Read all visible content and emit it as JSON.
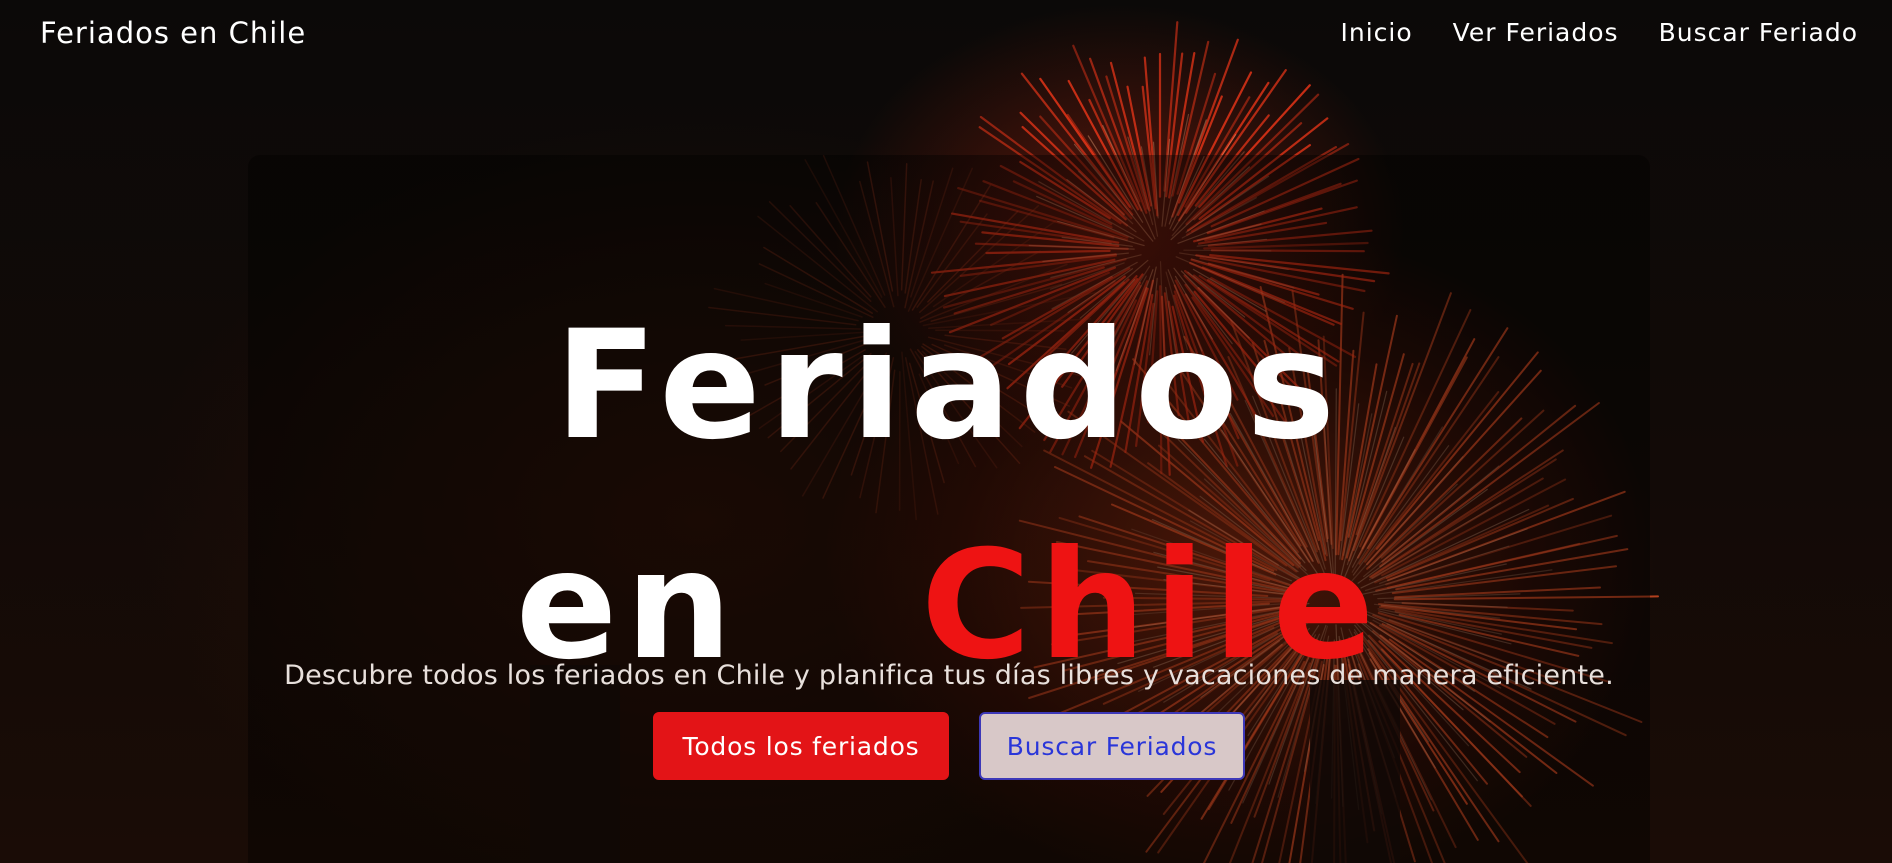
{
  "navbar": {
    "brand": "Feriados en Chile",
    "links": [
      "Inicio",
      "Ver Feriados",
      "Buscar Feriado"
    ]
  },
  "hero": {
    "title_line_1": "Feriados",
    "title_line_2_white": "en",
    "title_line_2_red": "Chile",
    "subtitle": "Descubre todos los feriados en Chile y planifica tus días libres y vacaciones de manera eficiente.",
    "primary_button": "Todos los feriados",
    "secondary_button": "Buscar Feriados"
  },
  "colors": {
    "accent_red": "#e31417",
    "title_red": "#ee1313",
    "secondary_button_text": "#2a36d9",
    "secondary_button_bg": "#d8c8c8"
  },
  "background_image": "fireworks-night-photo"
}
